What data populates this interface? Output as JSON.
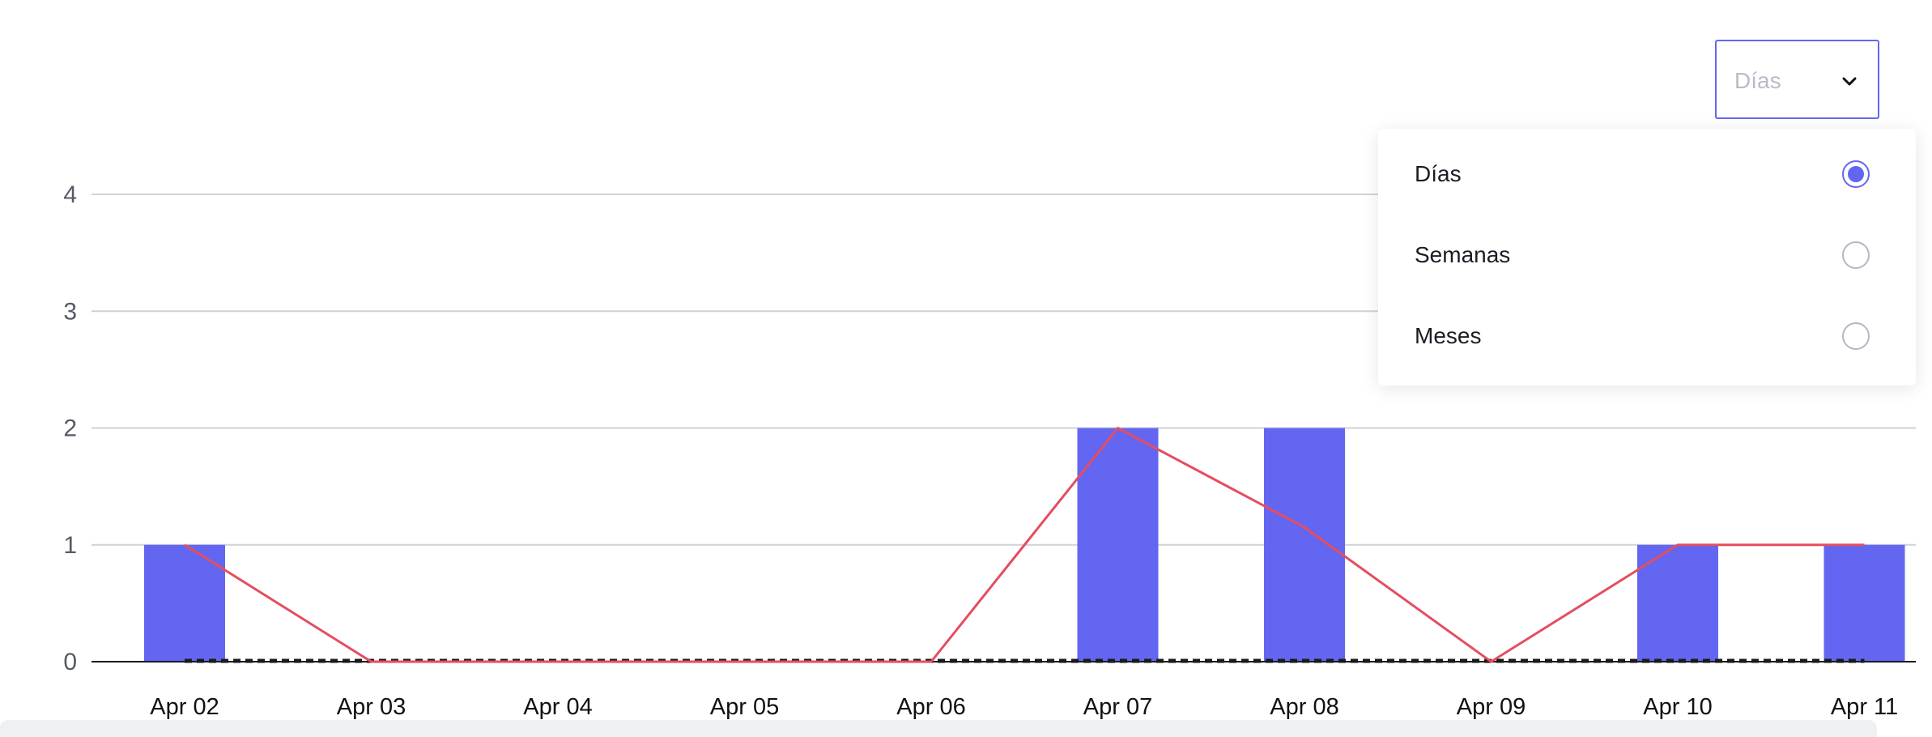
{
  "chart_data": {
    "type": "bar",
    "categories": [
      "Apr 02",
      "Apr 03",
      "Apr 04",
      "Apr 05",
      "Apr 06",
      "Apr 07",
      "Apr 08",
      "Apr 09",
      "Apr 10",
      "Apr 11"
    ],
    "series": [
      {
        "type": "bar",
        "values": [
          1,
          0,
          0,
          0,
          0,
          2,
          2,
          0,
          1,
          1
        ],
        "color": "#6366f1"
      },
      {
        "type": "line",
        "values": [
          1,
          0,
          0,
          0,
          0,
          2,
          1.15,
          0,
          1,
          1
        ],
        "color": "#e64d5f"
      }
    ],
    "baseline_dashed": true,
    "yticks": [
      0,
      1,
      2,
      3,
      4
    ],
    "ylim": [
      0,
      4
    ],
    "grid": true,
    "title": "",
    "xlabel": "",
    "ylabel": ""
  },
  "period_select": {
    "value": "Días",
    "options": [
      {
        "label": "Días",
        "selected": true
      },
      {
        "label": "Semanas",
        "selected": false
      },
      {
        "label": "Meses",
        "selected": false
      }
    ]
  },
  "colors": {
    "accent": "#6366f1",
    "line": "#e64d5f",
    "grid": "#cfd2d8",
    "axis": "#1a1a1a"
  }
}
